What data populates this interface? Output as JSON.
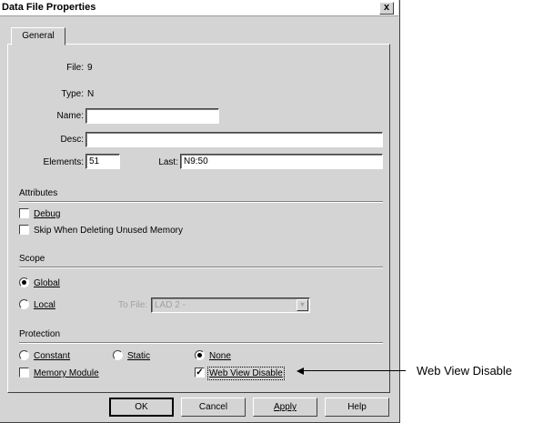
{
  "window": {
    "title": "Data File Properties",
    "close_label": "x"
  },
  "tabs": [
    {
      "label": "General"
    }
  ],
  "info": {
    "file_label": "File:",
    "file_value": "9",
    "type_label": "Type:",
    "type_value": "N"
  },
  "fields": {
    "name_label": "Name:",
    "name_value": "",
    "desc_label": "Desc:",
    "desc_value": "",
    "elements_label": "Elements:",
    "elements_value": "51",
    "last_label": "Last:",
    "last_value": "N9:50"
  },
  "attributes": {
    "heading": "Attributes",
    "debug": {
      "label": "Debug",
      "checked": false
    },
    "skip_unused": {
      "label": "Skip When Deleting Unused Memory",
      "checked": false
    }
  },
  "scope": {
    "heading": "Scope",
    "global_label": "Global",
    "local_label": "Local",
    "selected": "global",
    "to_file_label": "To File:",
    "to_file_value": "LAD 2 -"
  },
  "protection": {
    "heading": "Protection",
    "constant_label": "Constant",
    "static_label": "Static",
    "none_label": "None",
    "selected": "none",
    "memory_module": {
      "label": "Memory Module",
      "checked": false
    },
    "web_view_disable": {
      "label": "Web View Disable",
      "checked": true
    }
  },
  "buttons": {
    "ok": "OK",
    "cancel": "Cancel",
    "apply": "Apply",
    "help": "Help"
  },
  "callout": {
    "text": "Web View Disable"
  }
}
